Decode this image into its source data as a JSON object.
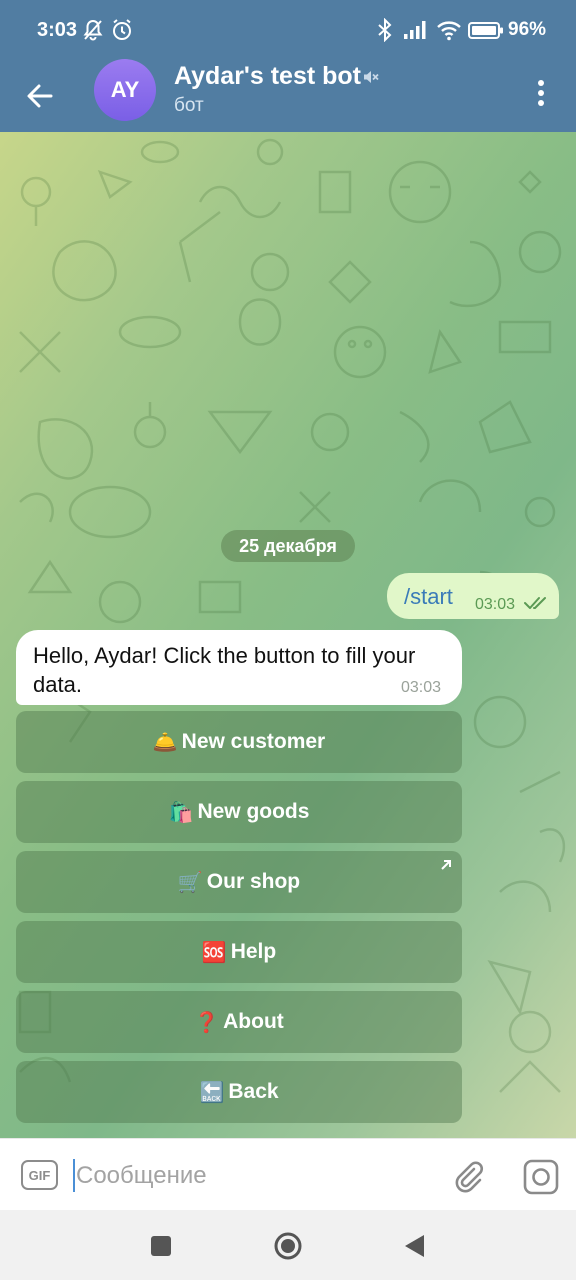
{
  "status_bar": {
    "time": "3:03",
    "battery_percent": "96%"
  },
  "header": {
    "avatar_initials": "AY",
    "avatar_color": "#8a6cec",
    "title": "Aydar's test bot",
    "subtitle": "бот"
  },
  "chat": {
    "date_label": "25 декабря",
    "messages": [
      {
        "direction": "out",
        "text": "/start",
        "time": "03:03",
        "status": "read"
      },
      {
        "direction": "in",
        "text": "Hello, Aydar! Click the button to fill your data.",
        "time": "03:03"
      }
    ],
    "keyboard": [
      {
        "emoji": "🛎️",
        "label": "New customer"
      },
      {
        "emoji": "🛍️",
        "label": "New goods"
      },
      {
        "emoji": "🛒",
        "label": "Our shop",
        "web_app": true
      },
      {
        "emoji": "🆘",
        "label": "Help"
      },
      {
        "emoji": "❓",
        "label": "About"
      },
      {
        "emoji": "🔙",
        "label": "Back"
      }
    ]
  },
  "input": {
    "gif_label": "GIF",
    "placeholder": "Сообщение",
    "value": ""
  },
  "colors": {
    "header_bg": "#517da2",
    "outgoing_bubble": "#e1f7c9",
    "incoming_bubble": "#ffffff",
    "link_text": "#3a7bb8"
  }
}
